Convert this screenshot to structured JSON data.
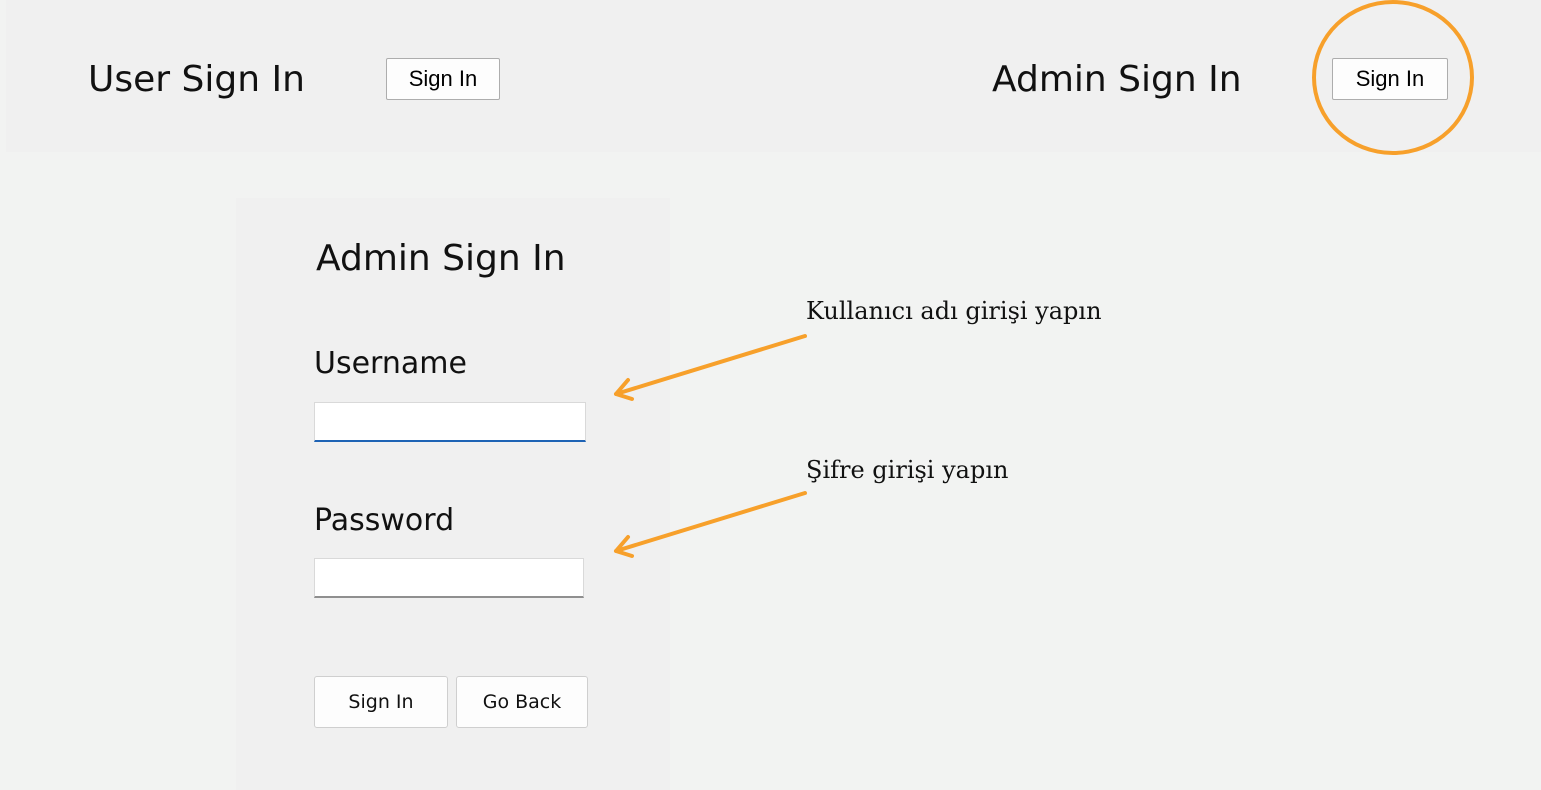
{
  "header": {
    "user_label": "User Sign In",
    "user_button": "Sign In",
    "admin_label": "Admin Sign In",
    "admin_button": "Sign In"
  },
  "form": {
    "title": "Admin Sign In",
    "username_label": "Username",
    "username_value": "",
    "password_label": "Password",
    "password_value": "",
    "signin_button": "Sign In",
    "goback_button": "Go Back"
  },
  "annotations": {
    "username_hint": "Kullanıcı adı girişi yapın",
    "password_hint": "Şifre girişi yapın"
  },
  "colors": {
    "accent": "#f7a02b",
    "focus": "#1e63b5"
  }
}
